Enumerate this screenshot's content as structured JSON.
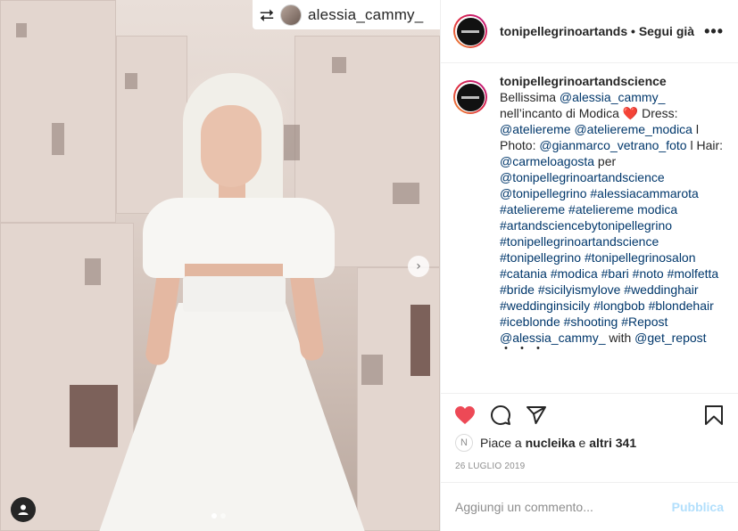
{
  "repost": {
    "username": "alessia_cammy_",
    "icon": "repost-icon"
  },
  "header": {
    "username": "tonipellegrinoartands",
    "separator": " • ",
    "follow_label": "Segui già",
    "more_label": "•••"
  },
  "caption": {
    "username": "tonipellegrinoartandscience",
    "segments": [
      {
        "text": "Bellissima ",
        "link": false
      },
      {
        "text": "@alessia_cammy_",
        "link": true
      },
      {
        "text": " nell’incanto di Modica ",
        "link": false
      },
      {
        "text": "❤️",
        "link": false,
        "emoji": true
      },
      {
        "text": " Dress: ",
        "link": false
      },
      {
        "text": "@ateliereme",
        "link": true
      },
      {
        "text": " ",
        "link": false
      },
      {
        "text": "@ateliereme_modica",
        "link": true
      },
      {
        "text": " l Photo: ",
        "link": false
      },
      {
        "text": "@gianmarco_vetrano_foto",
        "link": true
      },
      {
        "text": " l Hair: ",
        "link": false
      },
      {
        "text": "@carmeloagosta",
        "link": true
      },
      {
        "text": " per ",
        "link": false
      },
      {
        "text": "@tonipellegrinoartandscience",
        "link": true
      },
      {
        "text": " ",
        "link": false
      },
      {
        "text": "@tonipellegrino",
        "link": true
      },
      {
        "text": " ",
        "link": false
      },
      {
        "text": "#alessiacammarota",
        "link": true
      },
      {
        "text": " ",
        "link": false
      },
      {
        "text": "#ateliereme",
        "link": true
      },
      {
        "text": " ",
        "link": false
      },
      {
        "text": "#ateliereme modica",
        "link": true
      },
      {
        "text": " ",
        "link": false
      },
      {
        "text": "#artandsciencebytonipellegrino",
        "link": true
      },
      {
        "text": " ",
        "link": false
      },
      {
        "text": "#tonipellegrinoartandscience",
        "link": true
      },
      {
        "text": " ",
        "link": false
      },
      {
        "text": "#tonipellegrino",
        "link": true
      },
      {
        "text": " ",
        "link": false
      },
      {
        "text": "#tonipellegrinosalon",
        "link": true
      },
      {
        "text": " ",
        "link": false
      },
      {
        "text": "#catania",
        "link": true
      },
      {
        "text": " ",
        "link": false
      },
      {
        "text": "#modica",
        "link": true
      },
      {
        "text": " ",
        "link": false
      },
      {
        "text": "#bari",
        "link": true
      },
      {
        "text": " ",
        "link": false
      },
      {
        "text": "#noto",
        "link": true
      },
      {
        "text": " ",
        "link": false
      },
      {
        "text": "#molfetta",
        "link": true
      },
      {
        "text": " ",
        "link": false
      },
      {
        "text": "#bride",
        "link": true
      },
      {
        "text": " ",
        "link": false
      },
      {
        "text": "#sicilyismylove",
        "link": true
      },
      {
        "text": " ",
        "link": false
      },
      {
        "text": "#weddinghair",
        "link": true
      },
      {
        "text": " ",
        "link": false
      },
      {
        "text": "#weddinginsicily",
        "link": true
      },
      {
        "text": " ",
        "link": false
      },
      {
        "text": "#longbob",
        "link": true
      },
      {
        "text": " ",
        "link": false
      },
      {
        "text": "#blondehair",
        "link": true
      },
      {
        "text": " ",
        "link": false
      },
      {
        "text": "#iceblonde",
        "link": true
      },
      {
        "text": " ",
        "link": false
      },
      {
        "text": "#shooting",
        "link": true
      },
      {
        "text": " ",
        "link": false
      },
      {
        "text": "#Repost",
        "link": true
      },
      {
        "text": " ",
        "link": false
      },
      {
        "text": "@alessia_cammy_",
        "link": true
      },
      {
        "text": " with ",
        "link": false
      },
      {
        "text": "@get_repost",
        "link": true
      }
    ],
    "trailing": "・・・"
  },
  "actions": {
    "like_icon": "heart-filled-icon",
    "comment_icon": "comment-icon",
    "share_icon": "send-icon",
    "save_icon": "bookmark-icon",
    "like_color": "#ed4956"
  },
  "likes": {
    "prefix": "Piace a ",
    "user": "nucleika",
    "middle": " e ",
    "others": "altri 341"
  },
  "date": "26 LUGLIO 2019",
  "comment": {
    "placeholder": "Aggiungi un commento...",
    "publish_label": "Pubblica"
  },
  "carousel": {
    "next_icon": "chevron-right-icon",
    "total_slides": 2,
    "active_slide": 1
  }
}
